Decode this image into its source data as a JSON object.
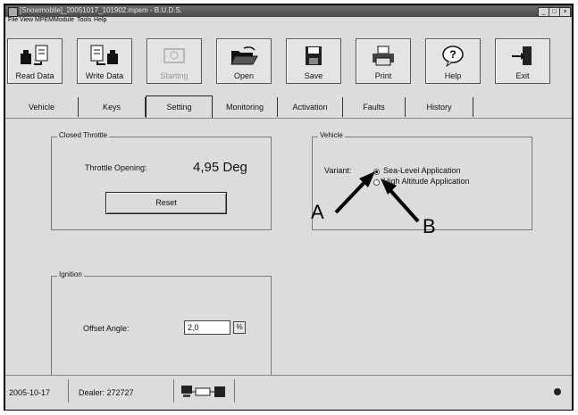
{
  "window": {
    "title": "[Snowmobile]_20051017_101902.mpem - B.U.D.S.",
    "controls": [
      "minimize-icon",
      "maximize-icon",
      "close-icon"
    ]
  },
  "menu": [
    "File",
    "View",
    "MPEM",
    "Module",
    "Tools",
    "Help"
  ],
  "toolbar": {
    "buttons": [
      {
        "label": "Read Data",
        "icon": "read-data-icon",
        "enabled": true
      },
      {
        "label": "Write Data",
        "icon": "write-data-icon",
        "enabled": true
      },
      {
        "label": "Starting",
        "icon": "starting-icon",
        "enabled": false
      },
      {
        "label": "Open",
        "icon": "folder-open-icon",
        "enabled": true
      },
      {
        "label": "Save",
        "icon": "floppy-disk-icon",
        "enabled": true
      },
      {
        "label": "Print",
        "icon": "printer-icon",
        "enabled": true
      },
      {
        "label": "Help",
        "icon": "help-icon",
        "enabled": true
      },
      {
        "label": "Exit",
        "icon": "exit-icon",
        "enabled": true
      }
    ]
  },
  "tabs": [
    "Vehicle",
    "Keys",
    "Setting",
    "Monitoring",
    "Activation",
    "Faults",
    "History"
  ],
  "active_tab": "Setting",
  "closed_throttle": {
    "caption": "Closed Throttle",
    "opening_label": "Throttle Opening:",
    "opening_value": "4,95 Deg",
    "reset_label": "Reset"
  },
  "vehicle_group": {
    "caption": "Vehicle",
    "variant_label": "Variant:",
    "options": [
      {
        "label": "Sea-Level Application",
        "selected": true
      },
      {
        "label": "High Altitude Application",
        "selected": false
      }
    ]
  },
  "callouts": {
    "a": "A",
    "b": "B"
  },
  "ignition": {
    "caption": "Ignition",
    "offset_label": "Offset Angle:",
    "offset_value": "2,0",
    "spin_symbol": "%"
  },
  "status": {
    "date": "2005-10-17",
    "dealer": "Dealer: 272727"
  }
}
